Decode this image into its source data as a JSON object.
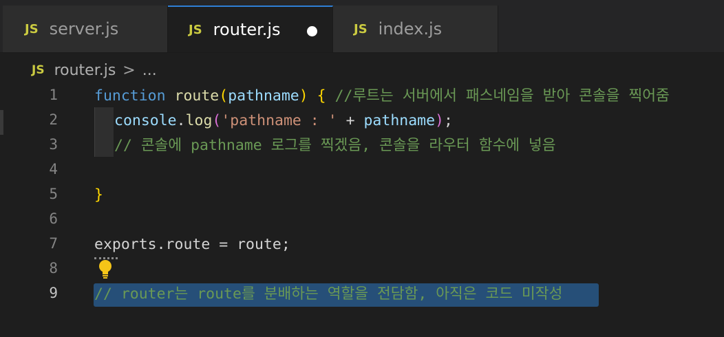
{
  "tabs": [
    {
      "icon": "JS",
      "label": "server.js"
    },
    {
      "icon": "JS",
      "label": "router.js"
    },
    {
      "icon": "JS",
      "label": "index.js"
    }
  ],
  "breadcrumb": {
    "icon": "JS",
    "file": "router.js",
    "separator": ">",
    "more": "..."
  },
  "line_numbers": [
    "1",
    "2",
    "3",
    "4",
    "5",
    "6",
    "7",
    "8",
    "9"
  ],
  "code": {
    "l1": {
      "kw": "function",
      "fn": "route",
      "p1": "(",
      "param": "pathname",
      "p2": ")",
      "brace": "{",
      "comment": "//루트는 서버에서 패스네임을 받아 콘솔을 찍어줌"
    },
    "l2": {
      "obj": "console",
      "dot": ".",
      "fn": "log",
      "p1": "(",
      "str": "'pathname : '",
      "plus": " + ",
      "param": "pathname",
      "p2": ")",
      "semi": ";"
    },
    "l3": {
      "comment": "// 콘솔에 pathname 로그를 찍겠음, 콘솔을 라우터 함수에 넣음"
    },
    "l5": {
      "brace": "}"
    },
    "l7": {
      "text": "exports.route = route;"
    },
    "l9": {
      "comment": "// router는 route를 분배하는 역할을 전담함, 아직은 코드 미작성"
    }
  },
  "colors": {
    "accent": "#2f7fd6",
    "js_icon": "#cbcb41",
    "selection": "#264f78"
  }
}
